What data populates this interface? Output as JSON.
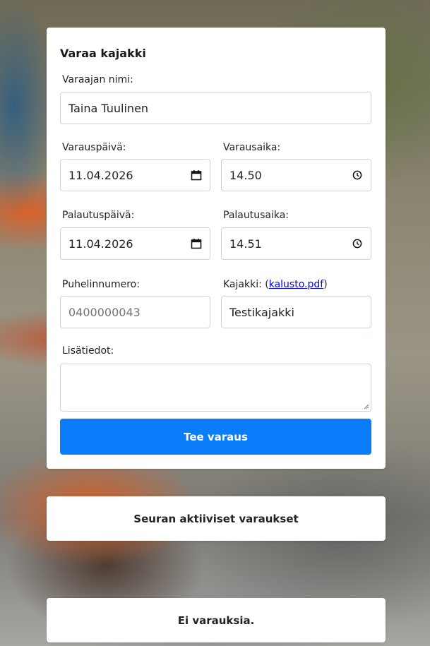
{
  "form": {
    "title": "Varaa kajakki",
    "name_label": "Varaajan nimi:",
    "name_value": "Taina Tuulinen",
    "date_label": "Varauspäivä:",
    "date_value": "11.04.2026",
    "time_label": "Varausaika:",
    "time_value": "14.50",
    "return_date_label": "Palautuspäivä:",
    "return_date_value": "11.04.2026",
    "return_time_label": "Palautusaika:",
    "return_time_value": "14.51",
    "phone_label": "Puhelinnumero:",
    "phone_placeholder": "0400000043",
    "kayak_label_prefix": "Kajakki: (",
    "kayak_link": "kalusto.pdf",
    "kayak_label_suffix": ")",
    "kayak_value": "Testikajakki",
    "info_label": "Lisätiedot:",
    "submit_label": "Tee varaus"
  },
  "active_reservations": {
    "title": "Seuran aktiiviset varaukset"
  },
  "reservations_status": {
    "text": "Ei varauksia."
  },
  "colors": {
    "primary_button": "#0b7dfb",
    "card_background": "#ffffff"
  },
  "icons": {
    "date": "calendar-icon",
    "time": "clock-icon",
    "resize": "resize-handle-icon"
  }
}
